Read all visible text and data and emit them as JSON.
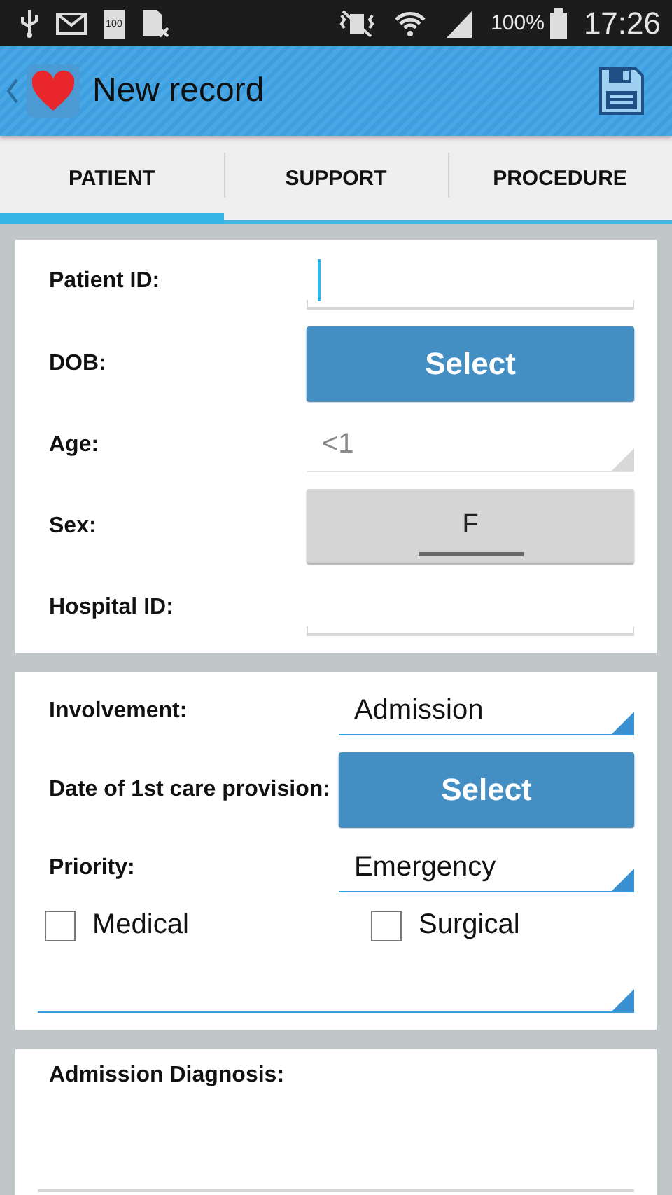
{
  "status_bar": {
    "battery_badge": "100",
    "battery": "100%",
    "time": "17:26"
  },
  "app_bar": {
    "title": "New record"
  },
  "tabs": [
    {
      "label": "PATIENT",
      "selected": true
    },
    {
      "label": "SUPPORT",
      "selected": false
    },
    {
      "label": "PROCEDURE",
      "selected": false
    }
  ],
  "sections": [
    {
      "rows": [
        {
          "kind": "text",
          "label": "Patient ID:",
          "focused": true
        },
        {
          "kind": "button",
          "label": "DOB:",
          "value": "Select"
        },
        {
          "kind": "spinner",
          "label": "Age:",
          "value": "<1",
          "disabled": true
        },
        {
          "kind": "toggle",
          "label": "Sex:",
          "value": "F",
          "on": false
        },
        {
          "kind": "text",
          "label": "Hospital ID:",
          "focused": false
        }
      ]
    },
    {
      "rows": [
        {
          "kind": "spinner",
          "label": "Involvement:",
          "value": "Admission",
          "disabled": false
        },
        {
          "kind": "button",
          "label": "Date of 1st care provision:",
          "value": "Select"
        },
        {
          "kind": "spinner",
          "label": "Priority:",
          "value": "Emergency",
          "disabled": false
        },
        {
          "kind": "checks",
          "items": [
            {
              "label": "Medical",
              "checked": false
            },
            {
              "label": "Surgical",
              "checked": false
            }
          ]
        },
        {
          "kind": "spinner",
          "disabled": false
        }
      ]
    },
    {
      "rows": [
        {
          "kind": "textarea",
          "label": "Admission Diagnosis:",
          "focused": false
        }
      ]
    }
  ]
}
